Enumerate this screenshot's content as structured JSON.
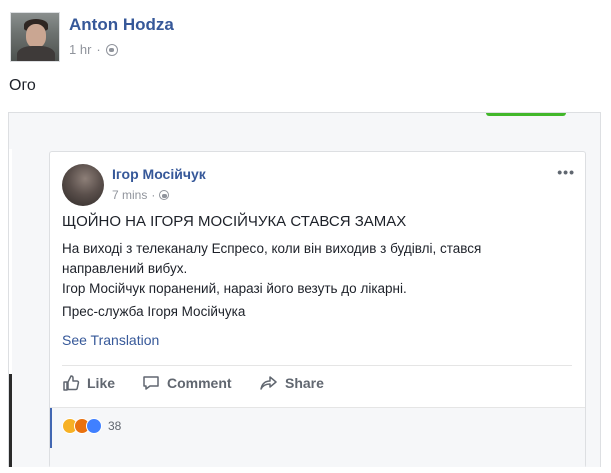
{
  "post": {
    "author": "Anton Hodza",
    "time": "1 hr",
    "separator": "·",
    "text": "Ого"
  },
  "shared": {
    "author": "Ігор Мосійчук",
    "time": "7 mins",
    "separator": "·",
    "more": "•••",
    "headline": "ЩОЙНО НА ІГОРЯ МОСІЙЧУКА СТАВСЯ ЗАМАХ",
    "body_lines": [
      "На виході з телеканалу Еспресо, коли він виходив з будівлі, стався",
      "направлений вибух.",
      "Ігор Мосійчук поранений, наразі його везуть до лікарні."
    ],
    "signature": "Прес-служба Ігоря Мосійчука",
    "see_translation": "See Translation"
  },
  "actions": {
    "like": "Like",
    "comment": "Comment",
    "share": "Share"
  },
  "reactions": {
    "icons": [
      "wow-reaction-icon",
      "angry-reaction-icon",
      "like-reaction-icon"
    ],
    "count": "38"
  },
  "colors": {
    "link_blue": "#365899",
    "meta_gray": "#90949c",
    "accent_green": "#42b72a"
  }
}
